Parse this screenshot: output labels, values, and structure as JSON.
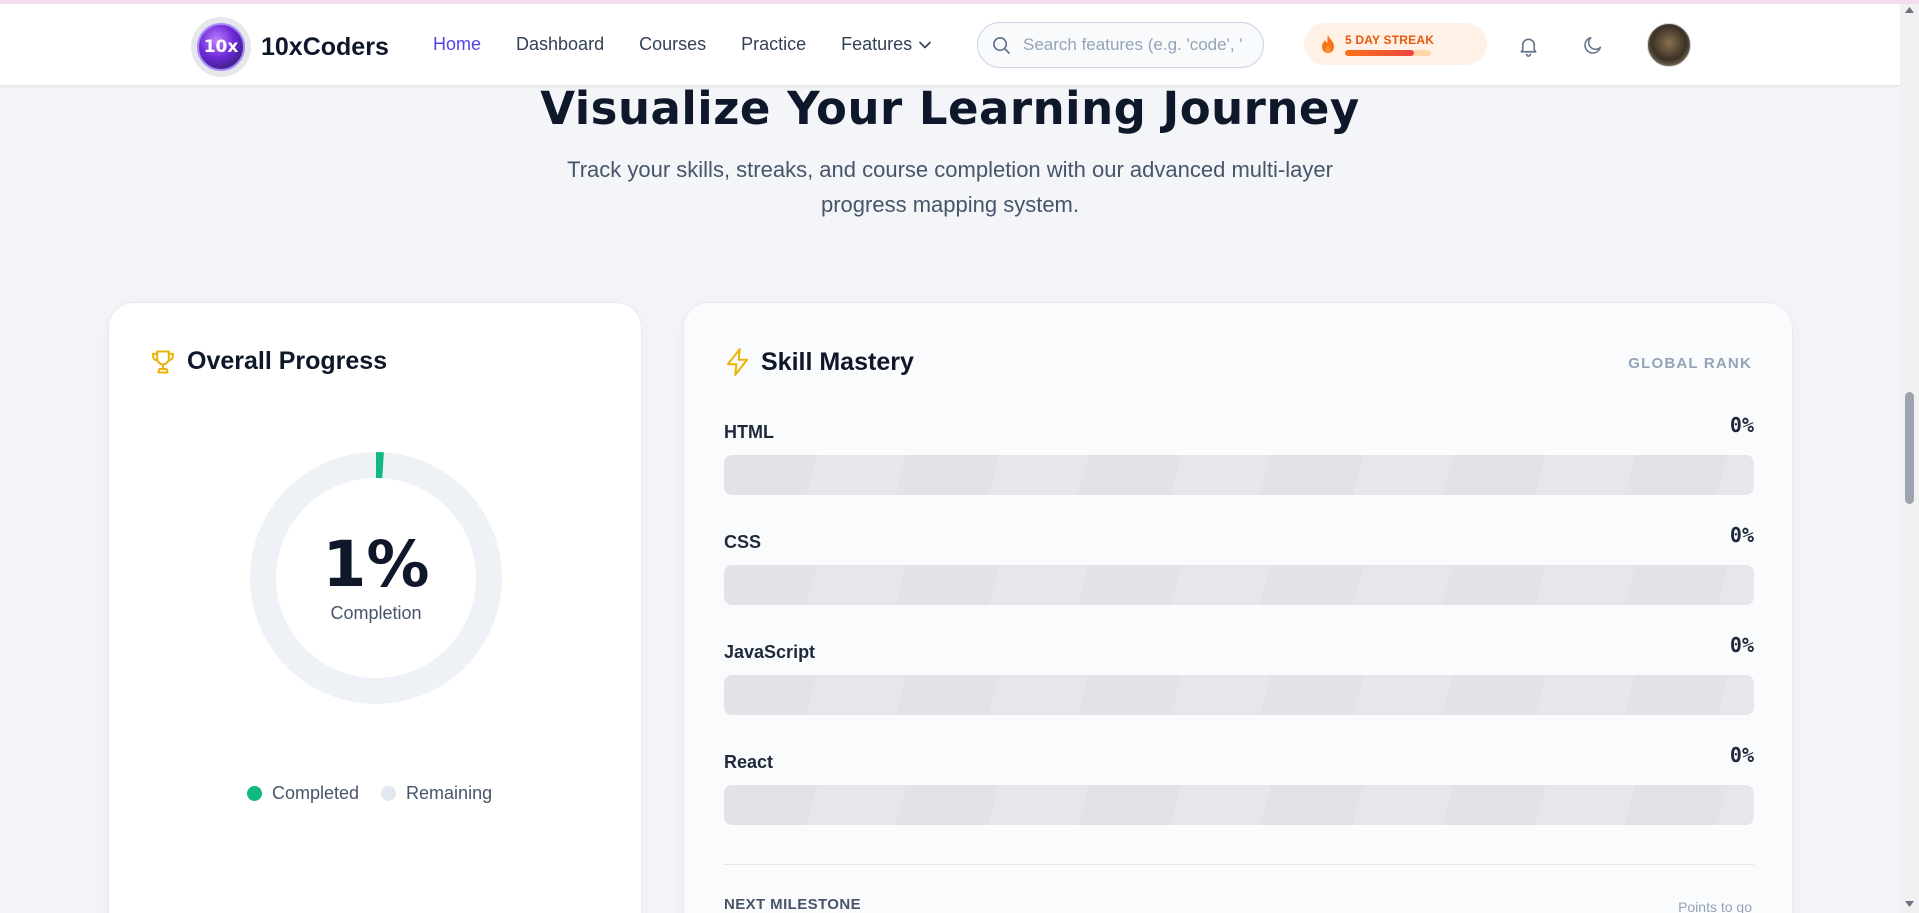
{
  "nav": {
    "brand": "10xCoders",
    "logo_text": "10x",
    "links": [
      {
        "label": "Home",
        "active": true
      },
      {
        "label": "Dashboard",
        "active": false
      },
      {
        "label": "Courses",
        "active": false
      },
      {
        "label": "Practice",
        "active": false
      }
    ],
    "features_label": "Features",
    "search_placeholder": "Search features (e.g. 'code', '",
    "streak_label": "5 DAY STREAK",
    "streak_progress": 0.8
  },
  "hero": {
    "title": "Visualize Your Learning Journey",
    "subtitle": "Track your skills, streaks, and course completion with our advanced multi-layer progress mapping system."
  },
  "overall": {
    "title": "Overall Progress",
    "percent_label": "1%",
    "percent_value": 1,
    "caption": "Completion",
    "legend": [
      {
        "label": "Completed",
        "color": "#10b981"
      },
      {
        "label": "Remaining",
        "color": "#e2e8f0"
      }
    ]
  },
  "skills": {
    "title": "Skill Mastery",
    "rank_label": "GLOBAL RANK",
    "items": [
      {
        "name": "HTML",
        "percent_label": "0%",
        "percent": 0
      },
      {
        "name": "CSS",
        "percent_label": "0%",
        "percent": 0
      },
      {
        "name": "JavaScript",
        "percent_label": "0%",
        "percent": 0
      },
      {
        "name": "React",
        "percent_label": "0%",
        "percent": 0
      }
    ],
    "milestone_label": "NEXT MILESTONE",
    "points_label": "Points to go"
  },
  "colors": {
    "accent": "#4f46e5",
    "completed": "#10b981",
    "streak": "#ea580c",
    "trophy": "#eab308"
  }
}
